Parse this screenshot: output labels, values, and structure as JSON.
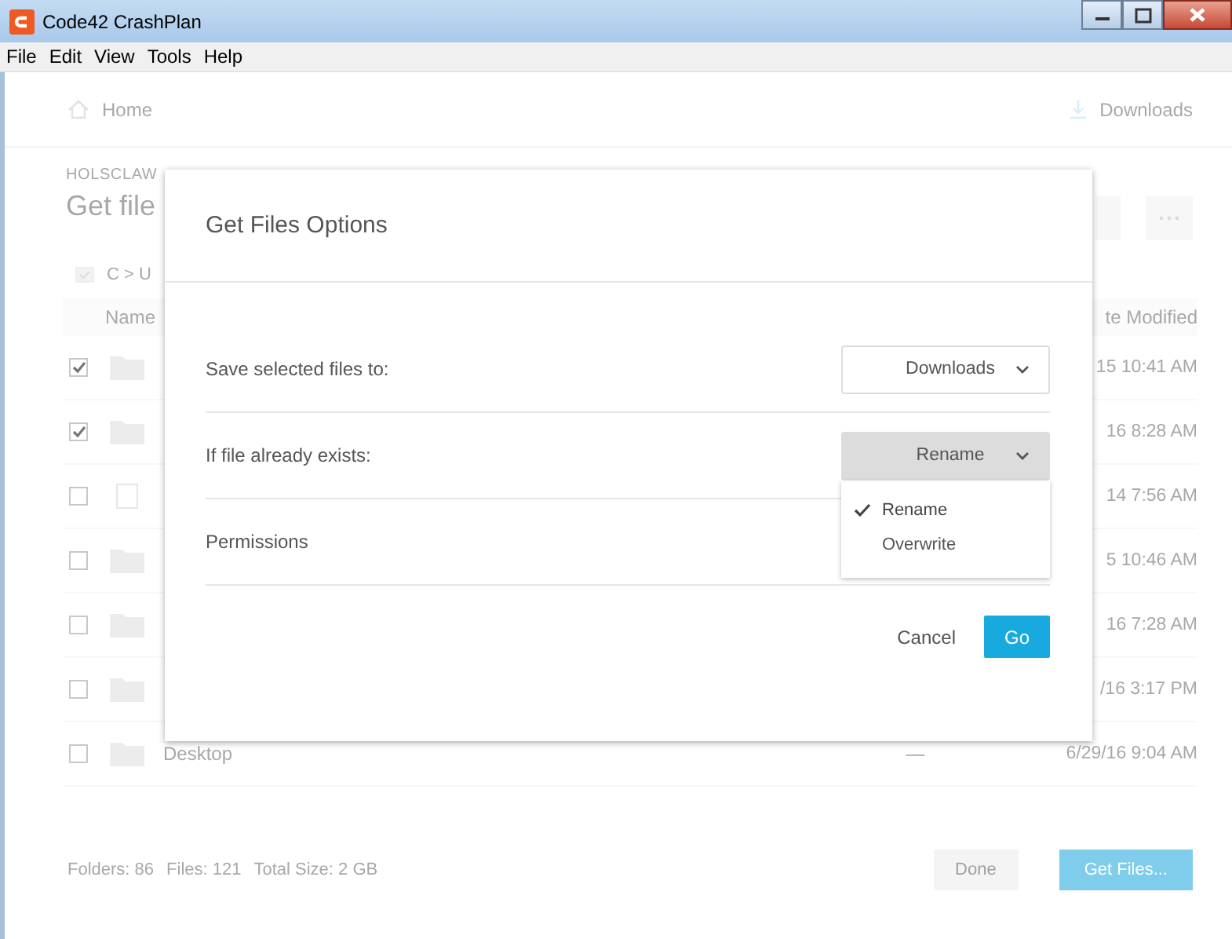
{
  "window": {
    "title": "Code42 CrashPlan"
  },
  "menu": [
    "File",
    "Edit",
    "View",
    "Tools",
    "Help"
  ],
  "nav": {
    "home": "Home",
    "downloads": "Downloads"
  },
  "header": {
    "device": "HOLSCLAW",
    "title": "Get file",
    "breadcrumb": "C > U"
  },
  "table": {
    "columns": [
      "Name",
      "te Modified"
    ],
    "rows": [
      {
        "kind": "folder",
        "checked": true,
        "modified": "15 10:41 AM"
      },
      {
        "kind": "folder",
        "checked": true,
        "modified": "16 8:28 AM"
      },
      {
        "kind": "file",
        "checked": false,
        "modified": "14 7:56 AM"
      },
      {
        "kind": "folder",
        "checked": false,
        "modified": "5 10:46 AM"
      },
      {
        "kind": "folder",
        "checked": false,
        "modified": "16 7:28 AM"
      },
      {
        "kind": "folder",
        "checked": false,
        "modified": "/16 3:17 PM"
      },
      {
        "kind": "folder",
        "checked": false,
        "name": "Desktop",
        "size": "—",
        "modified": "6/29/16 9:04 AM"
      }
    ]
  },
  "footer": {
    "stats": [
      "Folders: 86",
      "Files: 121",
      "Total Size: 2 GB"
    ],
    "buttons": [
      {
        "label": "Done",
        "kind": "secondary"
      },
      {
        "label": "Get Files...",
        "kind": "primary"
      }
    ]
  },
  "dialog": {
    "title": "Get Files Options",
    "options": [
      {
        "label": "Save selected files to:",
        "kind": "dropdown",
        "value": "Downloads",
        "open": false
      },
      {
        "label": "If file already exists:",
        "kind": "dropdown",
        "value": "Rename",
        "open": true,
        "menu": [
          {
            "label": "Rename",
            "selected": true
          },
          {
            "label": "Overwrite",
            "selected": false
          }
        ]
      },
      {
        "label": "Permissions",
        "kind": "text"
      }
    ],
    "buttons": [
      {
        "label": "Cancel",
        "kind": "secondary"
      },
      {
        "label": "Go",
        "kind": "primary"
      }
    ]
  }
}
